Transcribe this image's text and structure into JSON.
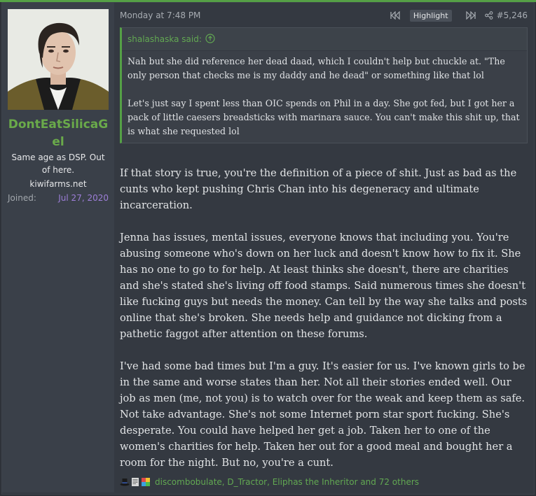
{
  "post": {
    "timestamp": "Monday at 7:48 PM",
    "highlight_label": "Highlight",
    "post_number": "#5,246"
  },
  "user": {
    "name": "DontEatSilicaGel",
    "title": "Same age as DSP. Out of here.",
    "url": "kiwifarms.net",
    "joined_label": "Joined:",
    "joined_date": "Jul 27, 2020"
  },
  "quote": {
    "author_said": "shalashaska said:",
    "paragraphs": [
      "Nah but she did reference her dead daad, which I couldn't help but chuckle at. \"The only person that checks me is my daddy and he dead\" or something like that lol",
      "Let's just say I spent less than OIC spends on Phil in a day. She got fed, but I got her a pack of little caesers breadsticks with marinara sauce. You can't make this shit up, that is what she requested lol"
    ]
  },
  "message": {
    "paragraphs": [
      "If that story is true, you're the definition of a piece of shit. Just as bad as the cunts who kept pushing Chris Chan into his degeneracy and ultimate incarceration.",
      "Jenna has issues, mental issues, everyone knows that including you. You're abusing someone who's down on her luck and doesn't know how to fix it. She has no one to go to for help. At least thinks she doesn't, there are charities and she's stated she's living off food stamps. Said numerous times she doesn't like fucking guys but needs the money. Can tell by the way she talks and posts online that she's broken. She needs help and guidance not dicking from a pathetic faggot after attention on these forums.",
      "I've had some bad times but I'm a guy. It's easier for us. I've known girls to be in the same and worse states than her. Not all their stories ended well. Our job as men (me, not you) is to watch over for the weak and keep them as safe. Not take advantage. She's not some Internet porn star sport fucking. She's desperate. You could have helped her get a job. Taken her to one of the women's charities for help. Taken her out for a good meal and bought her a room for the night. But no, you're a cunt."
    ]
  },
  "reactions": {
    "icons": [
      "top-hat-icon",
      "newspaper-icon",
      "puzzle-icon"
    ],
    "text": "discombobulate, D_Tractor, Eliphas the Inheritor and 72 others"
  },
  "colors": {
    "accent_green": "#55a046",
    "username_green": "#6aaa4a",
    "date_purple": "#9d7ed8",
    "panel_bg": "#3a4049",
    "post_bg": "#343941"
  }
}
